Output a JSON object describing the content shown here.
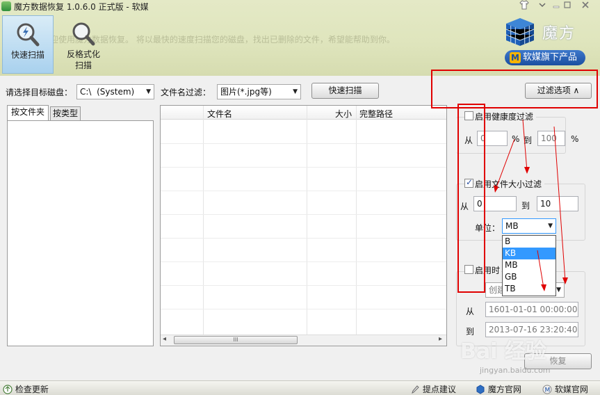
{
  "window": {
    "title": "魔方数据恢复 1.0.6.0 正式版 - 软媒",
    "controls": [
      "shirt-icon",
      "minimize-icon",
      "maximize-icon",
      "close-icon"
    ]
  },
  "toolbar": {
    "faded_text": "欢迎使用魔方数据恢复。 将以最快的速度扫描您的磁盘，找出已删除的文件，希望能帮助到你。",
    "quick_scan_label": "快速扫描",
    "deep_scan_label": "反格式化\n扫描"
  },
  "brand": {
    "logo_text": "魔方",
    "pill_icon": "M",
    "pill_text": "软媒旗下产品"
  },
  "scan_bar": {
    "disk_label": "请选择目标磁盘：",
    "disk_value": "C:\\  (System)",
    "filter_label": "文件名过滤：",
    "filter_value": "图片(*.jpg等)",
    "scan_button": "快速扫描",
    "filter_options_button": "过滤选项  ∧"
  },
  "tabs": [
    "按文件夹",
    "按类型"
  ],
  "file_table": {
    "columns": [
      "文件名",
      "大小",
      "完整路径"
    ],
    "rows": [],
    "scroll_arrow_left": "◂",
    "scroll_arrow_right": "▸",
    "scroll_thumb": "III"
  },
  "filters": {
    "health": {
      "label": "启用健康度过滤",
      "checked": false,
      "from_label": "从",
      "from_value": "0",
      "percent": "%",
      "to_label": "到",
      "to_value": "100",
      "percent2": "%"
    },
    "size": {
      "label": "启用文件大小过滤",
      "checked": true,
      "from_label": "从",
      "from_value": "0",
      "to_label": "到",
      "to_value": "10",
      "unit_label": "单位：",
      "unit_value": "MB",
      "unit_options": [
        "B",
        "KB",
        "MB",
        "GB",
        "TB"
      ],
      "highlighted_option": "KB"
    },
    "time": {
      "label": "启用时",
      "checked": false,
      "type_value": "创建",
      "from_label": "从",
      "from_value": "1601-01-01 00:00:00",
      "to_label": "到",
      "to_value": "2013-07-16 23:20:40"
    },
    "restore_button": "恢复"
  },
  "status_bar": {
    "check_update": "检查更新",
    "suggest": "提点建议",
    "mofang_site": "魔方官网",
    "ruanmei_site": "软媒官网"
  },
  "watermark": {
    "text": "Bai 经验",
    "sub": "jingyan.baidu.com"
  },
  "colors": {
    "annotation_red": "#e00000",
    "highlight_blue": "#3399ff",
    "brand_blue": "#1b4fa0"
  }
}
